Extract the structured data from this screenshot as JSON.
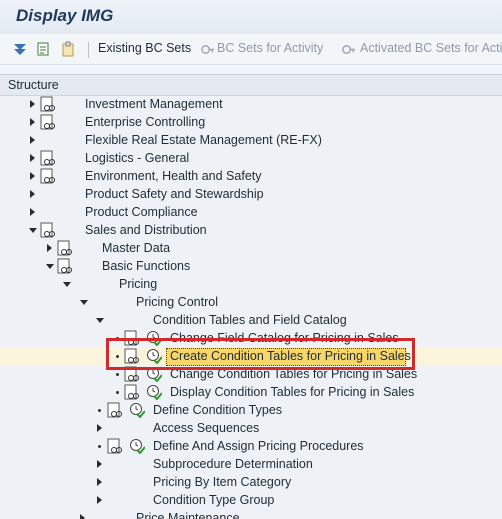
{
  "window": {
    "title": "Display IMG"
  },
  "toolbar": {
    "existing_bc_sets": "Existing BC Sets",
    "bc_sets_for_activity": "BC Sets for Activity",
    "activated_bc_sets": "Activated BC Sets for Activ"
  },
  "structure": {
    "header": "Structure",
    "rows": [
      {
        "label": "Investment Management"
      },
      {
        "label": "Enterprise Controlling"
      },
      {
        "label": "Flexible Real Estate Management (RE-FX)"
      },
      {
        "label": "Logistics - General"
      },
      {
        "label": "Environment, Health and Safety"
      },
      {
        "label": "Product Safety and Stewardship"
      },
      {
        "label": "Product Compliance"
      },
      {
        "label": "Sales and Distribution"
      },
      {
        "label": "Master Data"
      },
      {
        "label": "Basic Functions"
      },
      {
        "label": "Pricing"
      },
      {
        "label": "Pricing Control"
      },
      {
        "label": "Condition Tables and Field Catalog"
      },
      {
        "label": "Change Field Catalog for Pricing in Sales"
      },
      {
        "label": "Create Condition Tables for Pricing in Sales"
      },
      {
        "label": "Change Condition Tables for Pricing in Sales"
      },
      {
        "label": "Display Condition Tables for Pricing in Sales"
      },
      {
        "label": "Define Condition Types"
      },
      {
        "label": "Access Sequences"
      },
      {
        "label": "Define And Assign Pricing Procedures"
      },
      {
        "label": "Subprocedure Determination"
      },
      {
        "label": "Pricing By Item Category"
      },
      {
        "label": "Condition Type Group"
      },
      {
        "label": "Price Maintenance"
      }
    ]
  }
}
